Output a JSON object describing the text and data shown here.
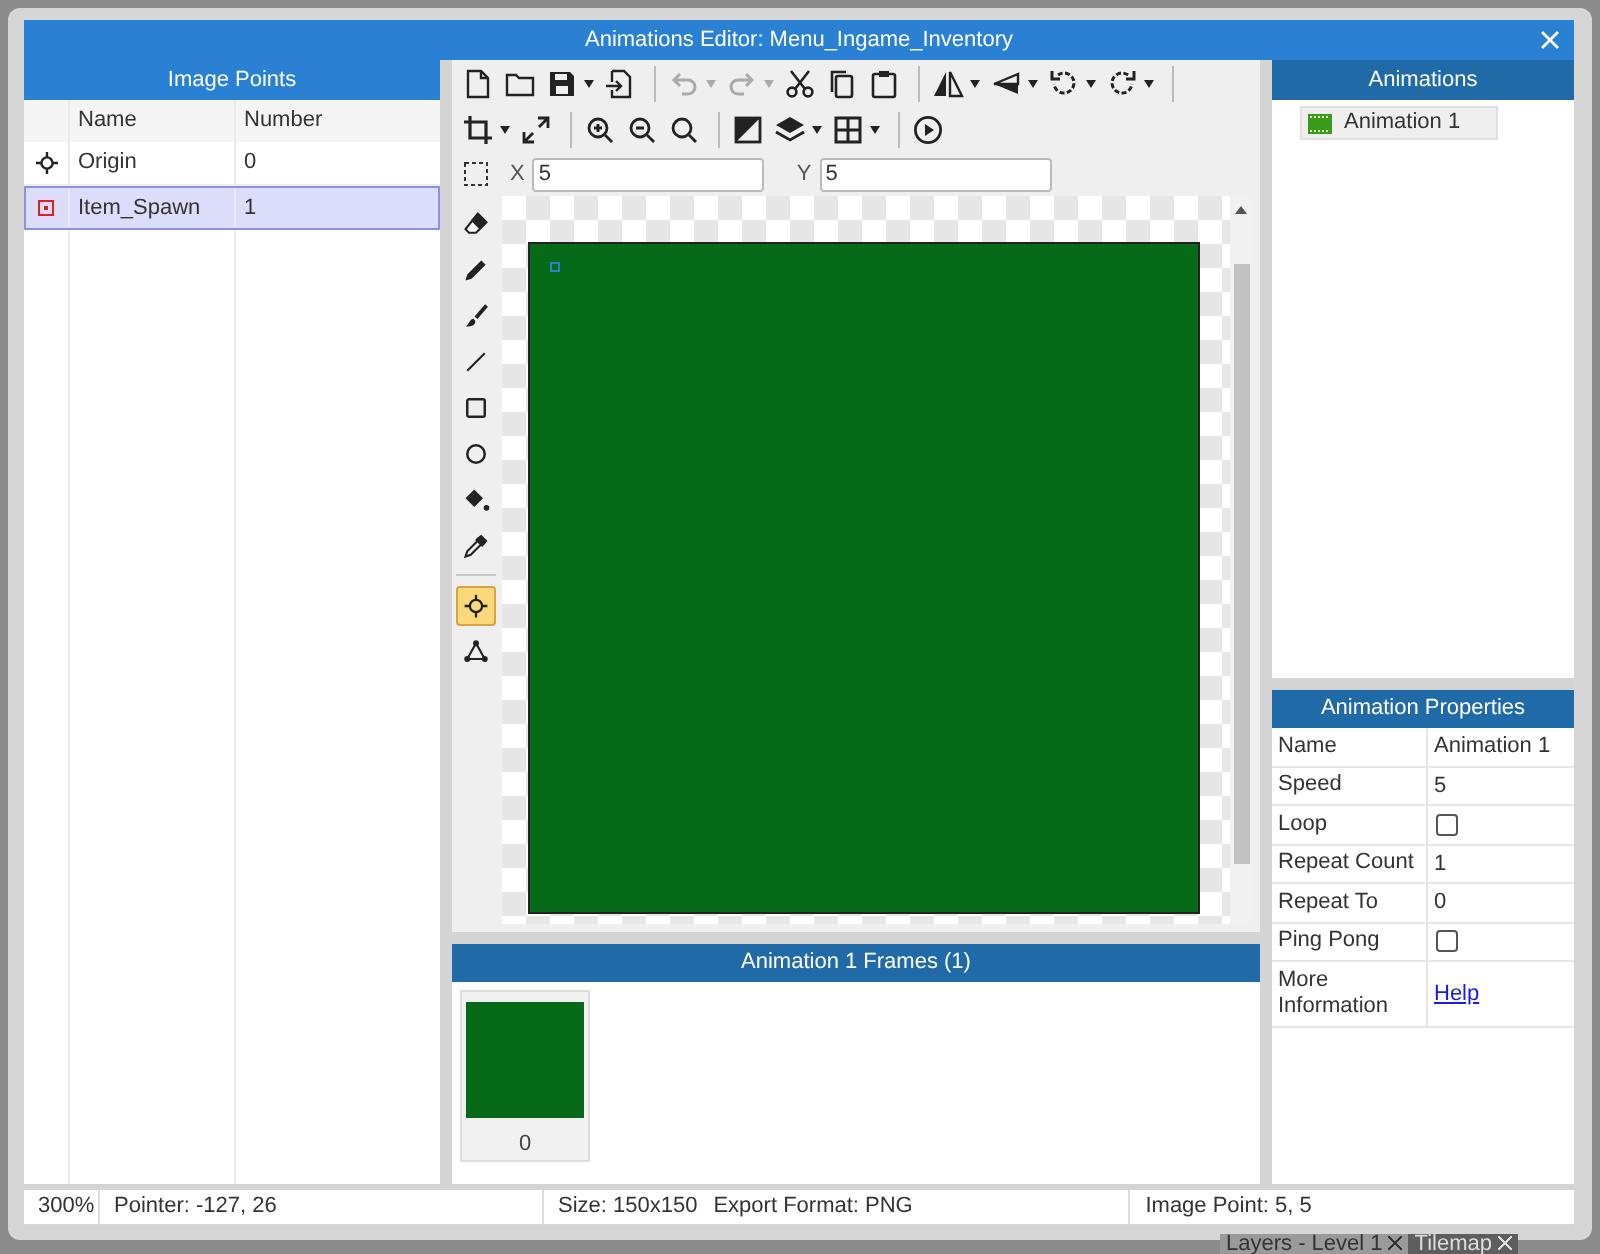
{
  "background": {
    "tabs": [
      {
        "label": "Layers - Level 1",
        "selected": true
      },
      {
        "label": "Tilemap",
        "selected": false
      }
    ]
  },
  "window": {
    "title": "Animations Editor: Menu_Ingame_Inventory"
  },
  "image_points": {
    "title": "Image Points",
    "columns": [
      "Name",
      "Number"
    ],
    "rows": [
      {
        "kind": "origin",
        "name": "Origin",
        "number": "0",
        "selected": false
      },
      {
        "kind": "point",
        "name": "Item_Spawn",
        "number": "1",
        "selected": true
      }
    ]
  },
  "toolbar": {
    "rows": [
      [
        {
          "kind": "new",
          "dropdown": false,
          "disabled": false
        },
        {
          "kind": "open",
          "dropdown": false,
          "disabled": false
        },
        {
          "kind": "save",
          "dropdown": true,
          "disabled": false
        },
        {
          "kind": "import",
          "dropdown": false,
          "disabled": false
        },
        {
          "kind": "sep"
        },
        {
          "kind": "undo",
          "dropdown": true,
          "disabled": true
        },
        {
          "kind": "redo",
          "dropdown": true,
          "disabled": true
        },
        {
          "kind": "cut",
          "dropdown": false,
          "disabled": false
        },
        {
          "kind": "copy",
          "dropdown": false,
          "disabled": false
        },
        {
          "kind": "paste",
          "dropdown": false,
          "disabled": false
        },
        {
          "kind": "sep"
        },
        {
          "kind": "flip-h",
          "dropdown": true,
          "disabled": false
        },
        {
          "kind": "flip-v",
          "dropdown": true,
          "disabled": false
        },
        {
          "kind": "rotate-ccw",
          "dropdown": true,
          "disabled": false
        },
        {
          "kind": "rotate-cw",
          "dropdown": true,
          "disabled": false
        },
        {
          "kind": "sep"
        }
      ],
      [
        {
          "kind": "crop",
          "dropdown": true,
          "disabled": false
        },
        {
          "kind": "resize",
          "dropdown": false,
          "disabled": false
        },
        {
          "kind": "sep"
        },
        {
          "kind": "zoom-in",
          "dropdown": false,
          "disabled": false
        },
        {
          "kind": "zoom-out",
          "dropdown": false,
          "disabled": false
        },
        {
          "kind": "zoom",
          "dropdown": false,
          "disabled": false
        },
        {
          "kind": "sep"
        },
        {
          "kind": "color",
          "dropdown": false,
          "disabled": false
        },
        {
          "kind": "layers",
          "dropdown": true,
          "disabled": false
        },
        {
          "kind": "grid",
          "dropdown": true,
          "disabled": false
        },
        {
          "kind": "sep"
        },
        {
          "kind": "play",
          "dropdown": false,
          "disabled": false
        }
      ]
    ],
    "x_label": "X",
    "x_value": "5",
    "y_label": "Y",
    "y_value": "5"
  },
  "tools": [
    {
      "kind": "eraser",
      "selected": false
    },
    {
      "kind": "pencil",
      "selected": false
    },
    {
      "kind": "brush",
      "selected": false
    },
    {
      "kind": "line",
      "selected": false
    },
    {
      "kind": "rect",
      "selected": false
    },
    {
      "kind": "ellipse",
      "selected": false
    },
    {
      "kind": "fill",
      "selected": false
    },
    {
      "kind": "picker",
      "selected": false
    },
    {
      "kind": "sep"
    },
    {
      "kind": "origin",
      "selected": true
    },
    {
      "kind": "mesh",
      "selected": false
    }
  ],
  "frames": {
    "title": "Animation 1 Frames (1)",
    "items": [
      {
        "label": "0",
        "selected": false
      }
    ]
  },
  "animations": {
    "title": "Animations",
    "items": [
      {
        "name": "Animation 1",
        "selected": false
      }
    ]
  },
  "properties": {
    "title": "Animation Properties",
    "rows": [
      {
        "kind": "text",
        "label": "Name",
        "value": "Animation 1"
      },
      {
        "kind": "text",
        "label": "Speed",
        "value": "5"
      },
      {
        "kind": "checkbox",
        "label": "Loop",
        "checked": false
      },
      {
        "kind": "text",
        "label": "Repeat Count",
        "value": "1"
      },
      {
        "kind": "text",
        "label": "Repeat To",
        "value": "0"
      },
      {
        "kind": "checkbox",
        "label": "Ping Pong",
        "checked": false
      },
      {
        "kind": "link",
        "label": "More Information",
        "value": "Help"
      }
    ]
  },
  "status_bar": {
    "zoom": "300%",
    "pointer": "Pointer: -127, 26",
    "size": "Size: 150x150",
    "export_format": "Export Format: PNG",
    "image_point": "Image Point: 5, 5"
  }
}
